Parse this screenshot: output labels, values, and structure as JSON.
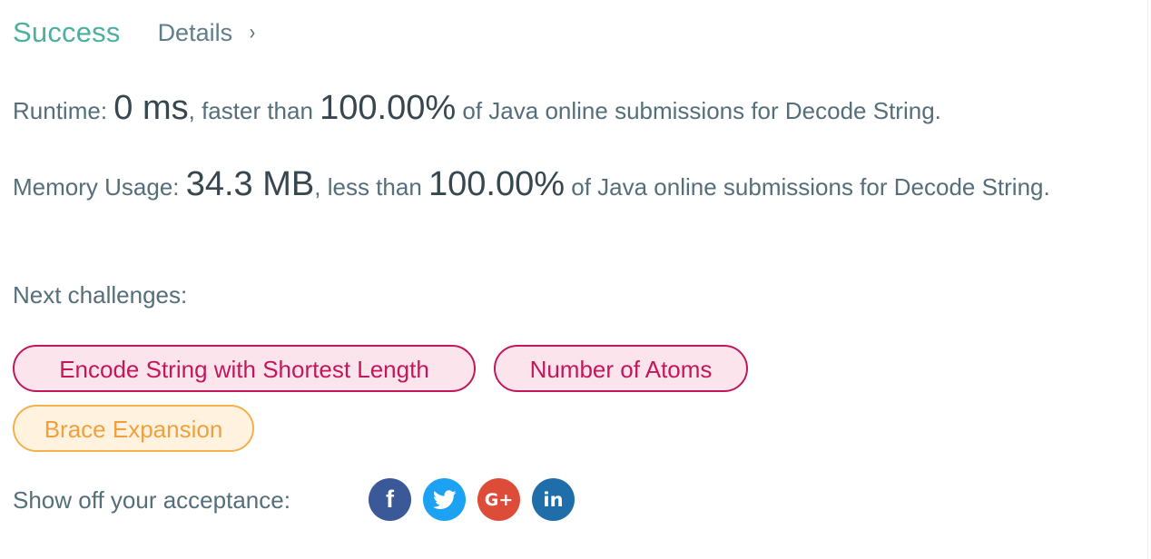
{
  "header": {
    "status": "Success",
    "details_label": "Details",
    "details_chevron": "›"
  },
  "runtime": {
    "label": "Runtime: ",
    "value": "0 ms",
    "middle": ", faster than ",
    "percent": "100.00%",
    "suffix": " of Java online submissions for Decode String."
  },
  "memory": {
    "label": "Memory Usage: ",
    "value": "34.3 MB",
    "middle": ", less than ",
    "percent": "100.00%",
    "suffix": " of Java online submissions for Decode String."
  },
  "next": {
    "label": "Next challenges:",
    "challenges": [
      {
        "title": "Encode String with Shortest Length",
        "difficulty": "hard"
      },
      {
        "title": "Number of Atoms",
        "difficulty": "hard"
      },
      {
        "title": "Brace Expansion",
        "difficulty": "medium"
      }
    ]
  },
  "share": {
    "label": "Show off your acceptance:",
    "icons": [
      {
        "name": "facebook-icon",
        "glyph": "f"
      },
      {
        "name": "twitter-icon",
        "glyph": "twitter-bird"
      },
      {
        "name": "google-plus-icon",
        "glyph": "G+"
      },
      {
        "name": "linkedin-icon",
        "glyph": "in"
      }
    ]
  },
  "colors": {
    "success": "#4bb0a0",
    "hard": "#c2185b",
    "hard_bg": "#fce4ec",
    "medium": "#f0a03c",
    "medium_bg": "#fff3e0",
    "facebook": "#3b5998",
    "twitter": "#1da1f2",
    "google_plus": "#dd4b39",
    "linkedin": "#1f6ea9"
  }
}
